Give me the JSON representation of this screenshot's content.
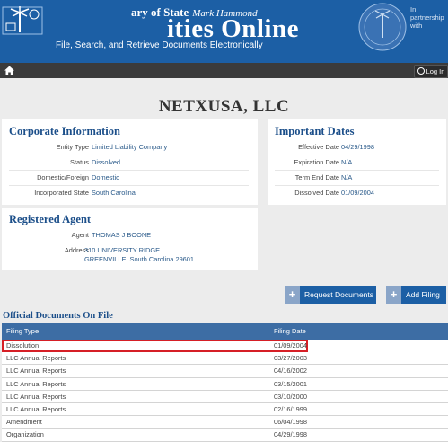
{
  "banner": {
    "line1": "ary of State",
    "signature": "Mark Hammond",
    "line2": "ities Online",
    "line3": "File, Search, and Retrieve Documents Electronically",
    "partner": "In partnership with"
  },
  "nav": {
    "home_icon": "home-icon",
    "login_label": "Log In"
  },
  "company": {
    "name": "NETXUSA, LLC"
  },
  "corporate": {
    "title": "Corporate Information",
    "fields": [
      {
        "label": "Entity Type",
        "value": "Limited Liability Company"
      },
      {
        "label": "Status",
        "value": "Dissolved"
      },
      {
        "label": "Domestic/Foreign",
        "value": "Domestic"
      },
      {
        "label": "Incorporated State",
        "value": "South Carolina"
      }
    ]
  },
  "dates": {
    "title": "Important Dates",
    "fields": [
      {
        "label": "Effective Date",
        "value": "04/29/1998"
      },
      {
        "label": "Expiration Date",
        "value": "N/A"
      },
      {
        "label": "Term End Date",
        "value": "N/A"
      },
      {
        "label": "Dissolved Date",
        "value": "01/09/2004"
      }
    ]
  },
  "agent": {
    "title": "Registered Agent",
    "agent_label": "Agent",
    "agent_value": "THOMAS J BOONE",
    "address_label": "Address",
    "address_line1": "310 UNIVERSITY RIDGE",
    "address_line2": "GREENVILLE, South Carolina   29601"
  },
  "actions": {
    "request_label": "Request Documents",
    "add_label": "Add Filing"
  },
  "documents": {
    "heading": "Official Documents On File",
    "col_type": "Filing Type",
    "col_date": "Filing Date",
    "rows": [
      {
        "type": "Dissolution",
        "date": "01/09/2004"
      },
      {
        "type": "LLC Annual Reports",
        "date": "03/27/2003"
      },
      {
        "type": "LLC Annual Reports",
        "date": "04/16/2002"
      },
      {
        "type": "LLC Annual Reports",
        "date": "03/15/2001"
      },
      {
        "type": "LLC Annual Reports",
        "date": "03/10/2000"
      },
      {
        "type": "LLC Annual Reports",
        "date": "02/16/1999"
      },
      {
        "type": "Amendment",
        "date": "06/04/1998"
      },
      {
        "type": "Organization",
        "date": "04/29/1998"
      }
    ]
  },
  "colors": {
    "brand_blue": "#1c5fa5",
    "nav_dark": "#3b3b3b",
    "highlight_red": "#d61f26"
  }
}
